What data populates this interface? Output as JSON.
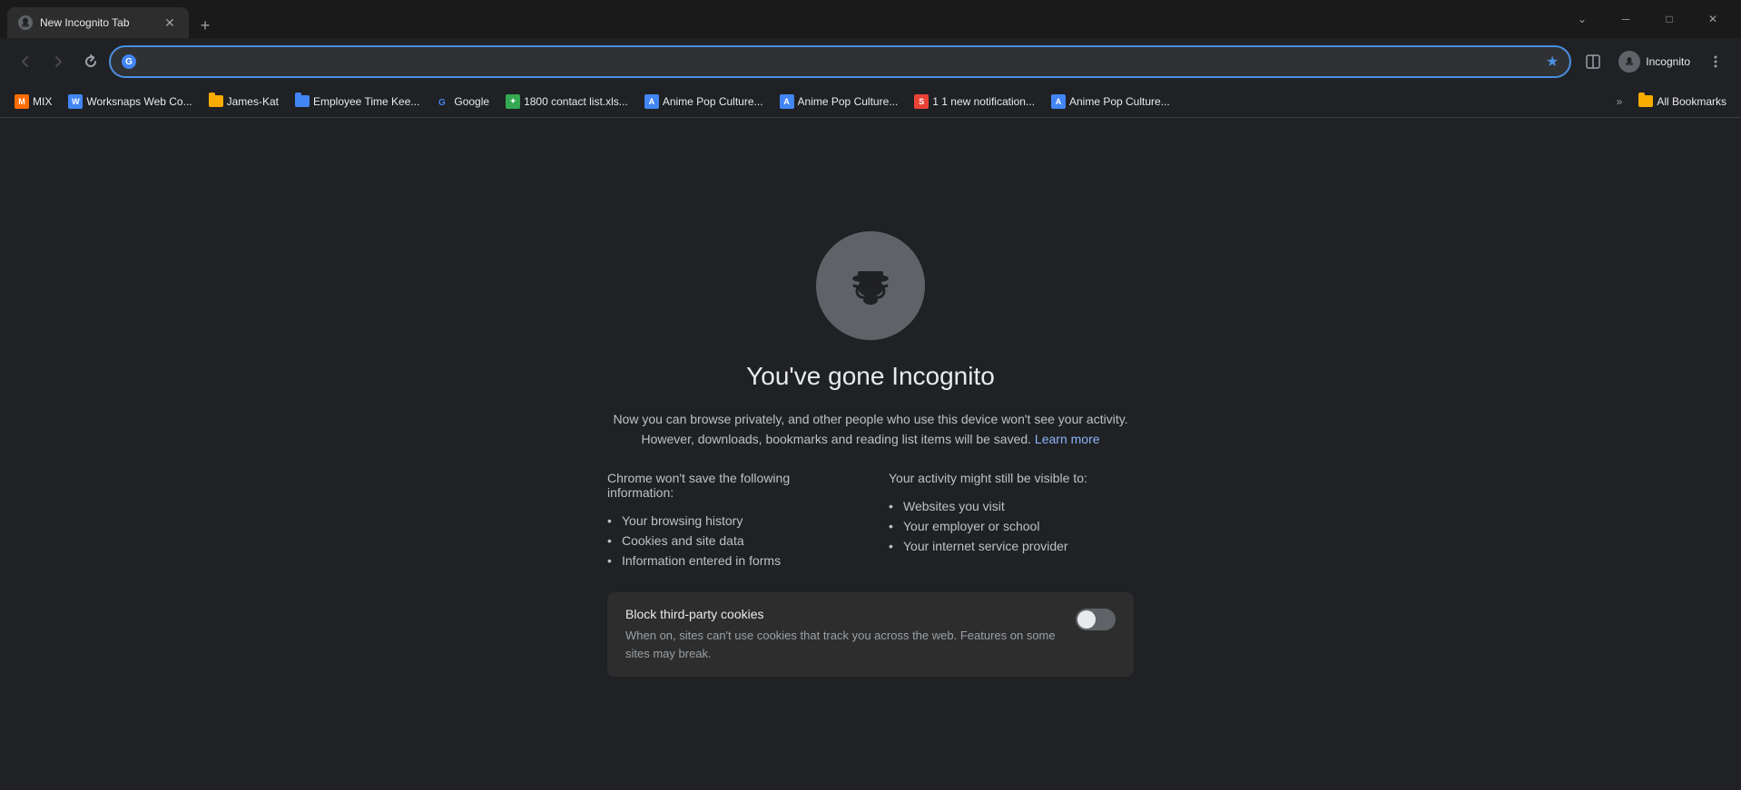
{
  "titleBar": {
    "tab": {
      "title": "New Incognito Tab",
      "favicon": "🕵️"
    },
    "newTabBtn": "+",
    "windowControls": {
      "minimize": "─",
      "maximize": "□",
      "close": "✕"
    },
    "dropdownBtn": "⌄"
  },
  "navBar": {
    "backBtn": "←",
    "forwardBtn": "→",
    "reloadBtn": "↻",
    "addressValue": "",
    "addressFavicon": "G",
    "bookmarkStar": "★",
    "splitViewBtn": "⧉",
    "profileIcon": "🕵️",
    "profileName": "Incognito",
    "menuBtn": "⋮"
  },
  "bookmarksBar": {
    "items": [
      {
        "id": "mix",
        "label": "MIX",
        "favicon": "🟠",
        "folderColor": "orange"
      },
      {
        "id": "worksnaps",
        "label": "Worksnaps Web Co...",
        "favicon": "W",
        "folderColor": "blue"
      },
      {
        "id": "james-kat",
        "label": "James-Kat",
        "favicon": "📁",
        "folderColor": "yellow"
      },
      {
        "id": "employee-time",
        "label": "Employee Time Kee...",
        "favicon": "📁",
        "folderColor": "blue"
      },
      {
        "id": "google",
        "label": "Google",
        "favicon": "G",
        "favicon_color": "#4285f4"
      },
      {
        "id": "1800-contact",
        "label": "1800 contact list.xls...",
        "favicon": "📊",
        "favicon_color": "#34a853"
      },
      {
        "id": "anime-pop-1",
        "label": "Anime Pop Culture...",
        "favicon": "A",
        "favicon_color": "#4285f4"
      },
      {
        "id": "anime-pop-2",
        "label": "Anime Pop Culture...",
        "favicon": "A",
        "favicon_color": "#4285f4"
      },
      {
        "id": "notif",
        "label": "1 1 new notification...",
        "favicon": "S",
        "favicon_color": "#ea4335"
      },
      {
        "id": "anime-pop-3",
        "label": "Anime Pop Culture...",
        "favicon": "A",
        "favicon_color": "#4285f4"
      }
    ],
    "moreBtn": "»",
    "allBookmarks": "All Bookmarks"
  },
  "pageContent": {
    "title": "You've gone Incognito",
    "descLine1": "Now you can browse privately, and other people who use this device won't see your activity.",
    "descLine2": "However, downloads, bookmarks and reading list items will be saved.",
    "learnMoreLink": "Learn more",
    "leftColHeading": "Chrome won't save the following information:",
    "leftColItems": [
      "Your browsing history",
      "Cookies and site data",
      "Information entered in forms"
    ],
    "rightColHeading": "Your activity might still be visible to:",
    "rightColItems": [
      "Websites you visit",
      "Your employer or school",
      "Your internet service provider"
    ],
    "cookieBox": {
      "title": "Block third-party cookies",
      "desc": "When on, sites can't use cookies that track you across the web. Features on some sites may break.",
      "toggleState": "off"
    }
  }
}
